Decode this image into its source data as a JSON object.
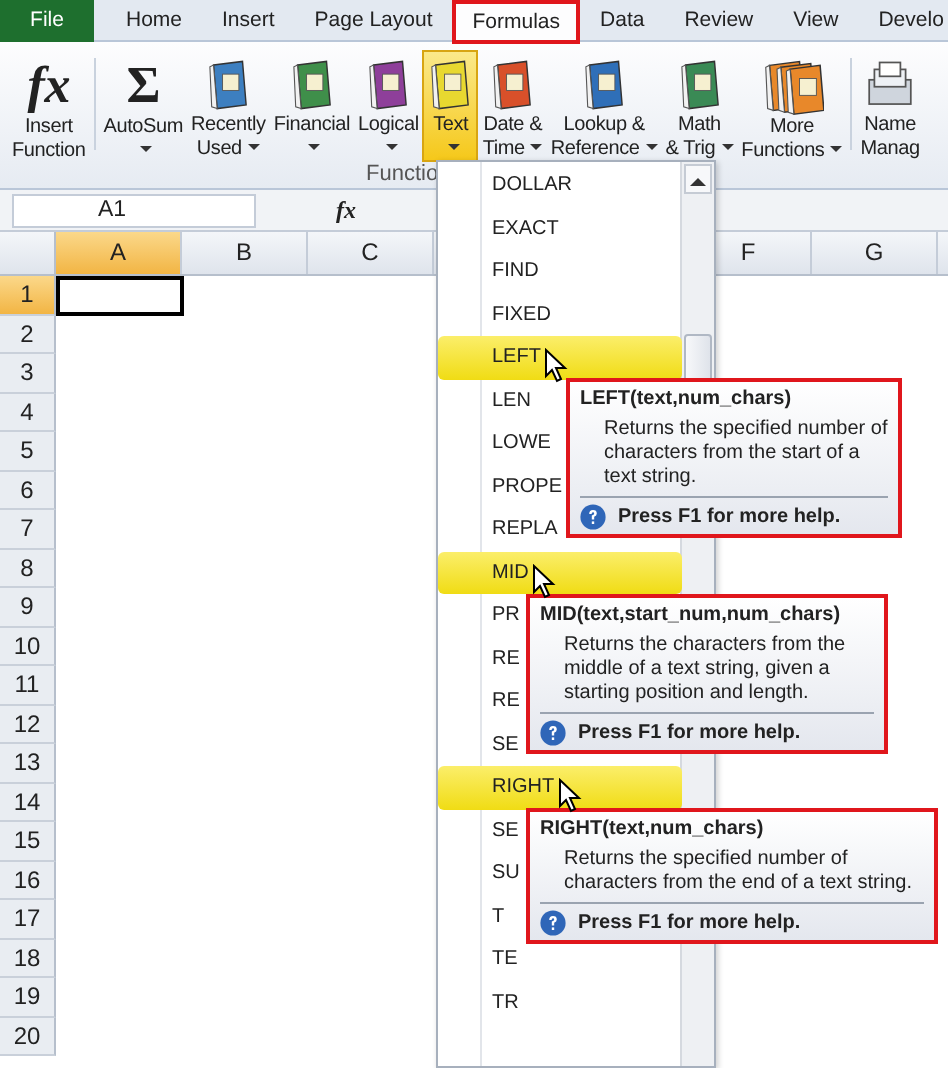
{
  "tabs": [
    {
      "label": "File",
      "kind": "file",
      "selected": false,
      "outlined": false
    },
    {
      "label": "Home",
      "kind": "tab",
      "selected": false,
      "outlined": false
    },
    {
      "label": "Insert",
      "kind": "tab",
      "selected": false,
      "outlined": false
    },
    {
      "label": "Page Layout",
      "kind": "tab",
      "selected": false,
      "outlined": false
    },
    {
      "label": "Formulas",
      "kind": "tab",
      "selected": true,
      "outlined": true
    },
    {
      "label": "Data",
      "kind": "tab",
      "selected": false,
      "outlined": false
    },
    {
      "label": "Review",
      "kind": "tab",
      "selected": false,
      "outlined": false
    },
    {
      "label": "View",
      "kind": "tab",
      "selected": false,
      "outlined": false
    },
    {
      "label": "Develo",
      "kind": "tab",
      "selected": false,
      "outlined": false
    }
  ],
  "ribbon": {
    "buttons": [
      {
        "label": "Insert\nFunction",
        "kind": "glyph",
        "glyph": "fx",
        "dropdown": false,
        "selected": false
      },
      {
        "label": "AutoSum",
        "kind": "glyph",
        "glyph": "Σ",
        "dropdown": true,
        "selected": false
      },
      {
        "label": "Recently\nUsed",
        "kind": "book",
        "color": "#3d7fc0",
        "dropdown": true,
        "selected": false
      },
      {
        "label": "Financial",
        "kind": "book",
        "color": "#3f8f4a",
        "dropdown": true,
        "selected": false
      },
      {
        "label": "Logical",
        "kind": "book",
        "color": "#8e3f9a",
        "dropdown": true,
        "selected": false
      },
      {
        "label": "Text",
        "kind": "book",
        "color": "#e8d830",
        "dropdown": true,
        "selected": true
      },
      {
        "label": "Date &\nTime",
        "kind": "book",
        "color": "#d8502a",
        "dropdown": true,
        "selected": false
      },
      {
        "label": "Lookup &\nReference",
        "kind": "book",
        "color": "#2f6fb8",
        "dropdown": true,
        "selected": false
      },
      {
        "label": "Math\n& Trig",
        "kind": "book",
        "color": "#3a8a55",
        "dropdown": true,
        "selected": false
      },
      {
        "label": "More\nFunctions",
        "kind": "books",
        "color": "#e8882a",
        "dropdown": true,
        "selected": false
      },
      {
        "label": "Name\nManag",
        "kind": "cards",
        "dropdown": false,
        "selected": false
      }
    ],
    "group_label": "Functio"
  },
  "name_box": {
    "value": "A1"
  },
  "formula_bar": {
    "glyph": "fx"
  },
  "sheet": {
    "columns": [
      {
        "label": "A",
        "selected": true
      },
      {
        "label": "B",
        "selected": false
      },
      {
        "label": "C",
        "selected": false
      },
      {
        "label": "F",
        "selected": false
      },
      {
        "label": "G",
        "selected": false
      }
    ],
    "rows": [
      {
        "label": "1",
        "selected": true
      },
      {
        "label": "2",
        "selected": false
      },
      {
        "label": "3",
        "selected": false
      },
      {
        "label": "4",
        "selected": false
      },
      {
        "label": "5",
        "selected": false
      },
      {
        "label": "6",
        "selected": false
      },
      {
        "label": "7",
        "selected": false
      },
      {
        "label": "8",
        "selected": false
      },
      {
        "label": "9",
        "selected": false
      },
      {
        "label": "10",
        "selected": false
      },
      {
        "label": "11",
        "selected": false
      },
      {
        "label": "12",
        "selected": false
      },
      {
        "label": "13",
        "selected": false
      },
      {
        "label": "14",
        "selected": false
      },
      {
        "label": "15",
        "selected": false
      },
      {
        "label": "16",
        "selected": false
      },
      {
        "label": "17",
        "selected": false
      },
      {
        "label": "18",
        "selected": false
      },
      {
        "label": "19",
        "selected": false
      },
      {
        "label": "20",
        "selected": false
      }
    ]
  },
  "dropdown": {
    "items": [
      {
        "label": "DOLLAR",
        "hovered": false
      },
      {
        "label": "EXACT",
        "hovered": false
      },
      {
        "label": "FIND",
        "hovered": false
      },
      {
        "label": "FIXED",
        "hovered": false
      },
      {
        "label": "LEFT",
        "hovered": true,
        "tooltip": {
          "title": "LEFT(text,num_chars)",
          "text": "Returns the specified number of characters from the start of a text string.",
          "help": "Press F1 for more help.",
          "outlined": true
        }
      },
      {
        "label": "LEN",
        "hovered": false
      },
      {
        "label": "LOWE",
        "hovered": false
      },
      {
        "label": "PROPE",
        "hovered": false
      },
      {
        "label": "REPLA",
        "hovered": false
      },
      {
        "label": "MID",
        "hovered": true,
        "tooltip": {
          "title": "MID(text,start_num,num_chars)",
          "text": "Returns the characters from the middle of a text string, given a starting position and length.",
          "help": "Press F1 for more help.",
          "outlined": true
        }
      },
      {
        "label": "PR",
        "hovered": false
      },
      {
        "label": "RE",
        "hovered": false
      },
      {
        "label": "RE",
        "hovered": false
      },
      {
        "label": "SE",
        "hovered": false
      },
      {
        "label": "RIGHT",
        "hovered": true,
        "tooltip": {
          "title": "RIGHT(text,num_chars)",
          "text": "Returns the specified number of characters from the end of a text string.",
          "help": "Press F1 for more help.",
          "outlined": true
        }
      },
      {
        "label": "SE",
        "hovered": false
      },
      {
        "label": "SU",
        "hovered": false
      },
      {
        "label": "T",
        "hovered": false
      },
      {
        "label": "TE",
        "hovered": false
      },
      {
        "label": "TR",
        "hovered": false
      }
    ]
  }
}
